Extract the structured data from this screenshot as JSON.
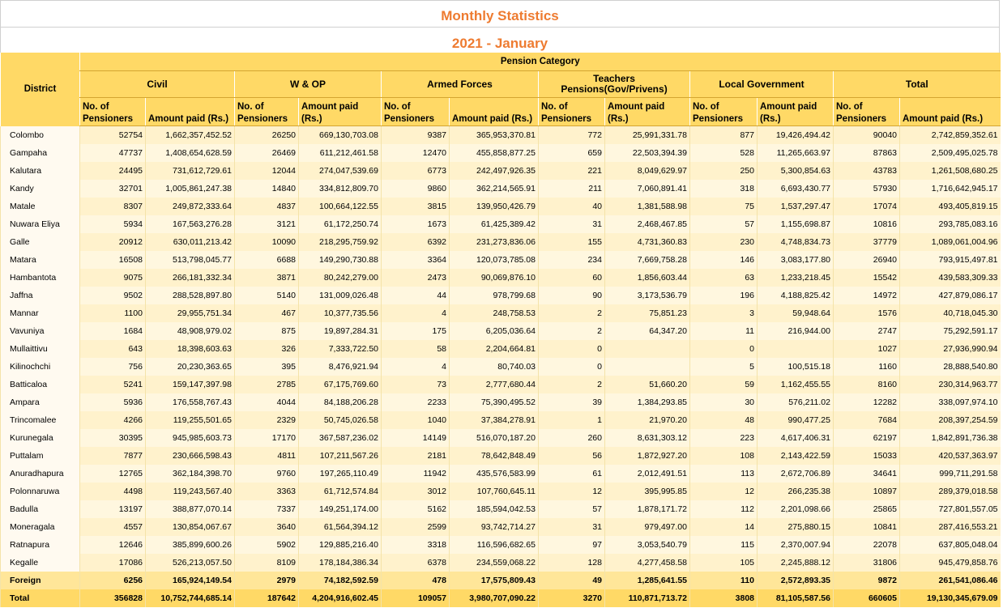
{
  "title": "Monthly Statistics",
  "subtitle": "2021 - January",
  "headers": {
    "district": "District",
    "pension_category": "Pension Category",
    "groups": [
      "Civil",
      "W & OP",
      "Armed Forces",
      "Teachers Pensions(Gov/Privens)",
      "Local Government",
      "Total"
    ],
    "no_of_pensioners": "No. of Pensioners",
    "amount_paid": "Amount paid (Rs.)"
  },
  "rows": [
    [
      "Colombo",
      "52754",
      "1,662,357,452.52",
      "26250",
      "669,130,703.08",
      "9387",
      "365,953,370.81",
      "772",
      "25,991,331.78",
      "877",
      "19,426,494.42",
      "90040",
      "2,742,859,352.61"
    ],
    [
      "Gampaha",
      "47737",
      "1,408,654,628.59",
      "26469",
      "611,212,461.58",
      "12470",
      "455,858,877.25",
      "659",
      "22,503,394.39",
      "528",
      "11,265,663.97",
      "87863",
      "2,509,495,025.78"
    ],
    [
      "Kalutara",
      "24495",
      "731,612,729.61",
      "12044",
      "274,047,539.69",
      "6773",
      "242,497,926.35",
      "221",
      "8,049,629.97",
      "250",
      "5,300,854.63",
      "43783",
      "1,261,508,680.25"
    ],
    [
      "Kandy",
      "32701",
      "1,005,861,247.38",
      "14840",
      "334,812,809.70",
      "9860",
      "362,214,565.91",
      "211",
      "7,060,891.41",
      "318",
      "6,693,430.77",
      "57930",
      "1,716,642,945.17"
    ],
    [
      "Matale",
      "8307",
      "249,872,333.64",
      "4837",
      "100,664,122.55",
      "3815",
      "139,950,426.79",
      "40",
      "1,381,588.98",
      "75",
      "1,537,297.47",
      "17074",
      "493,405,819.15"
    ],
    [
      "Nuwara Eliya",
      "5934",
      "167,563,276.28",
      "3121",
      "61,172,250.74",
      "1673",
      "61,425,389.42",
      "31",
      "2,468,467.85",
      "57",
      "1,155,698.87",
      "10816",
      "293,785,083.16"
    ],
    [
      "Galle",
      "20912",
      "630,011,213.42",
      "10090",
      "218,295,759.92",
      "6392",
      "231,273,836.06",
      "155",
      "4,731,360.83",
      "230",
      "4,748,834.73",
      "37779",
      "1,089,061,004.96"
    ],
    [
      "Matara",
      "16508",
      "513,798,045.77",
      "6688",
      "149,290,730.88",
      "3364",
      "120,073,785.08",
      "234",
      "7,669,758.28",
      "146",
      "3,083,177.80",
      "26940",
      "793,915,497.81"
    ],
    [
      "Hambantota",
      "9075",
      "266,181,332.34",
      "3871",
      "80,242,279.00",
      "2473",
      "90,069,876.10",
      "60",
      "1,856,603.44",
      "63",
      "1,233,218.45",
      "15542",
      "439,583,309.33"
    ],
    [
      "Jaffna",
      "9502",
      "288,528,897.80",
      "5140",
      "131,009,026.48",
      "44",
      "978,799.68",
      "90",
      "3,173,536.79",
      "196",
      "4,188,825.42",
      "14972",
      "427,879,086.17"
    ],
    [
      "Mannar",
      "1100",
      "29,955,751.34",
      "467",
      "10,377,735.56",
      "4",
      "248,758.53",
      "2",
      "75,851.23",
      "3",
      "59,948.64",
      "1576",
      "40,718,045.30"
    ],
    [
      "Vavuniya",
      "1684",
      "48,908,979.02",
      "875",
      "19,897,284.31",
      "175",
      "6,205,036.64",
      "2",
      "64,347.20",
      "11",
      "216,944.00",
      "2747",
      "75,292,591.17"
    ],
    [
      "Mullaittivu",
      "643",
      "18,398,603.63",
      "326",
      "7,333,722.50",
      "58",
      "2,204,664.81",
      "0",
      "",
      "0",
      "",
      "1027",
      "27,936,990.94"
    ],
    [
      "Kilinochchi",
      "756",
      "20,230,363.65",
      "395",
      "8,476,921.94",
      "4",
      "80,740.03",
      "0",
      "",
      "5",
      "100,515.18",
      "1160",
      "28,888,540.80"
    ],
    [
      "Batticaloa",
      "5241",
      "159,147,397.98",
      "2785",
      "67,175,769.60",
      "73",
      "2,777,680.44",
      "2",
      "51,660.20",
      "59",
      "1,162,455.55",
      "8160",
      "230,314,963.77"
    ],
    [
      "Ampara",
      "5936",
      "176,558,767.43",
      "4044",
      "84,188,206.28",
      "2233",
      "75,390,495.52",
      "39",
      "1,384,293.85",
      "30",
      "576,211.02",
      "12282",
      "338,097,974.10"
    ],
    [
      "Trincomalee",
      "4266",
      "119,255,501.65",
      "2329",
      "50,745,026.58",
      "1040",
      "37,384,278.91",
      "1",
      "21,970.20",
      "48",
      "990,477.25",
      "7684",
      "208,397,254.59"
    ],
    [
      "Kurunegala",
      "30395",
      "945,985,603.73",
      "17170",
      "367,587,236.02",
      "14149",
      "516,070,187.20",
      "260",
      "8,631,303.12",
      "223",
      "4,617,406.31",
      "62197",
      "1,842,891,736.38"
    ],
    [
      "Puttalam",
      "7877",
      "230,666,598.43",
      "4811",
      "107,211,567.26",
      "2181",
      "78,642,848.49",
      "56",
      "1,872,927.20",
      "108",
      "2,143,422.59",
      "15033",
      "420,537,363.97"
    ],
    [
      "Anuradhapura",
      "12765",
      "362,184,398.70",
      "9760",
      "197,265,110.49",
      "11942",
      "435,576,583.99",
      "61",
      "2,012,491.51",
      "113",
      "2,672,706.89",
      "34641",
      "999,711,291.58"
    ],
    [
      "Polonnaruwa",
      "4498",
      "119,243,567.40",
      "3363",
      "61,712,574.84",
      "3012",
      "107,760,645.11",
      "12",
      "395,995.85",
      "12",
      "266,235.38",
      "10897",
      "289,379,018.58"
    ],
    [
      "Badulla",
      "13197",
      "388,877,070.14",
      "7337",
      "149,251,174.00",
      "5162",
      "185,594,042.53",
      "57",
      "1,878,171.72",
      "112",
      "2,201,098.66",
      "25865",
      "727,801,557.05"
    ],
    [
      "Moneragala",
      "4557",
      "130,854,067.67",
      "3640",
      "61,564,394.12",
      "2599",
      "93,742,714.27",
      "31",
      "979,497.00",
      "14",
      "275,880.15",
      "10841",
      "287,416,553.21"
    ],
    [
      "Ratnapura",
      "12646",
      "385,899,600.26",
      "5902",
      "129,885,216.40",
      "3318",
      "116,596,682.65",
      "97",
      "3,053,540.79",
      "115",
      "2,370,007.94",
      "22078",
      "637,805,048.04"
    ],
    [
      "Kegalle",
      "17086",
      "526,213,057.50",
      "8109",
      "178,184,386.34",
      "6378",
      "234,559,068.22",
      "128",
      "4,277,458.58",
      "105",
      "2,245,888.12",
      "31806",
      "945,479,858.76"
    ],
    [
      "Foreign",
      "6256",
      "165,924,149.54",
      "2979",
      "74,182,592.59",
      "478",
      "17,575,809.43",
      "49",
      "1,285,641.55",
      "110",
      "2,572,893.35",
      "9872",
      "261,541,086.46"
    ],
    [
      "Total",
      "356828",
      "10,752,744,685.14",
      "187642",
      "4,204,916,602.45",
      "109057",
      "3,980,707,090.22",
      "3270",
      "110,871,713.72",
      "3808",
      "81,105,587.56",
      "660605",
      "19,130,345,679.09"
    ]
  ]
}
